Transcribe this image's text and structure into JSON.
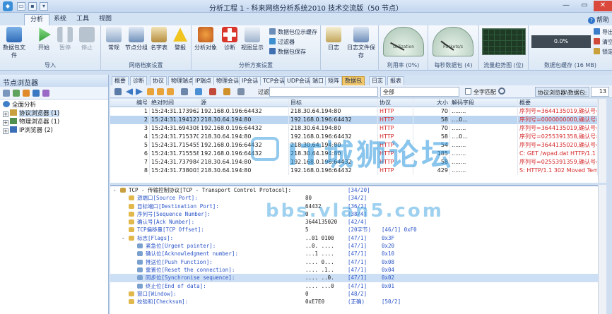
{
  "window": {
    "title": "分析工程 1 - 科来网络分析系统2010 技术交流版（50 节点）",
    "help_label": "帮助",
    "close_glyph": "✕",
    "minimize_glyph": "—",
    "maximize_glyph": "▭"
  },
  "ribbon_tabs": [
    "分析",
    "系统",
    "工具",
    "视图"
  ],
  "ribbon": {
    "groups": [
      {
        "label": "导入",
        "buttons": [
          {
            "label": "数据包文件"
          },
          {
            "label": "开始"
          },
          {
            "label": "暂停"
          },
          {
            "label": "停止"
          }
        ]
      },
      {
        "label": "网络档案设置",
        "buttons": [
          {
            "label": "常规"
          },
          {
            "label": "节点分组"
          },
          {
            "label": "名字表"
          },
          {
            "label": "警报"
          }
        ]
      },
      {
        "label": "分析方案设置",
        "buttons": [
          {
            "label": "分析对象"
          },
          {
            "label": "诊断"
          },
          {
            "label": "视图显示"
          }
        ],
        "small": [
          "数据包位示缓存",
          "过滤器",
          "数据包保存"
        ]
      },
      {
        "label": "",
        "buttons": [
          {
            "label": "日志"
          },
          {
            "label": "日志文件保存"
          }
        ]
      },
      {
        "label": "利用率 (0%)",
        "gauge": "Utilization"
      },
      {
        "label": "每秒数据包 (4)",
        "gauge": "Packets/s"
      },
      {
        "label": "流量趋势图 (位)"
      },
      {
        "label": "数据包缓存 (16 MB)",
        "buffer_value": "0.0%",
        "small": [
          "导出",
          "清空",
          "锁定"
        ]
      }
    ]
  },
  "left_panel": {
    "title": "节点浏览器",
    "tree": [
      {
        "label": "全面分析",
        "level": 0,
        "expander": ""
      },
      {
        "label": "协议浏览器 (1)",
        "level": 1,
        "expander": "+",
        "selected": true
      },
      {
        "label": "物理浏览器 (1)",
        "level": 1,
        "expander": "+"
      },
      {
        "label": "IP浏览器 (2)",
        "level": 1,
        "expander": "+"
      }
    ]
  },
  "doc_tabs": [
    "概要",
    "诊断",
    "协议",
    "物理端点",
    "IP端点",
    "物理会话",
    "IP会话",
    "TCP会话",
    "UDP会话",
    "端口",
    "矩阵",
    "数据包",
    "日志",
    "报表"
  ],
  "active_doc_tab": "数据包",
  "filter_bar": {
    "filter_label": "过滤:",
    "select_value": "全部",
    "match_label": "全字匹配",
    "browser_label": "协议浏览器\\数据包:",
    "count": "13"
  },
  "packets": {
    "columns": [
      "编号",
      "绝对时间",
      "源",
      "目标",
      "协议",
      "大小",
      "解码字段",
      "概要"
    ],
    "rows": [
      [
        "1",
        "15:24:31.173962",
        "192.168.0.196:64432",
        "218.30.64.194:80",
        "HTTP",
        "70",
        "........",
        "序列号=3644135019,确认号=0"
      ],
      [
        "2",
        "15:24:31.194121",
        "218.30.64.194:80",
        "192.168.0.196:64432",
        "HTTP",
        "58",
        "....0...",
        "序列号=0000000000,确认号=3"
      ],
      [
        "3",
        "15:24:31.694308",
        "192.168.0.196:64432",
        "218.30.64.194:80",
        "HTTP",
        "70",
        "........",
        "序列号=3644135019,确认号=0"
      ],
      [
        "4",
        "15:24:31.715370",
        "218.30.64.194:80",
        "192.168.0.196:64432",
        "HTTP",
        "58",
        "....0...",
        "序列号=0255391358,确认号=3"
      ],
      [
        "5",
        "15:24:31.715455",
        "192.168.0.196:64432",
        "218.30.64.194:80",
        "HTTP",
        "54",
        "........",
        "序列号=3644135020,确认号=0"
      ],
      [
        "6",
        "15:24:31.715558",
        "192.168.0.196:64432",
        "218.30.64.194:80",
        "HTTP",
        "185",
        "........",
        "C: GET /wpad.dat HTTP/1.1"
      ],
      [
        "7",
        "15:24:31.737984",
        "218.30.64.194:80",
        "192.168.0.196:64432",
        "HTTP",
        "58",
        "........",
        "序列号=0255391359,确认号=3"
      ],
      [
        "8",
        "15:24:31.738003",
        "218.30.64.194:80",
        "192.168.0.196:64432",
        "HTTP",
        "429",
        "........",
        "S: HTTP/1.1 302 Moved Temp"
      ]
    ]
  },
  "decode": {
    "rows": [
      {
        "indent": 0,
        "exp": "-",
        "name": "TCP - 传输控制协议[TCP - Transport Control Protocol]:",
        "value": "",
        "pos": "[34/20]",
        "extra": ""
      },
      {
        "indent": 1,
        "exp": "",
        "name": "源端口[Source Port]:",
        "value": "80",
        "pos": "[34/2]",
        "extra": ""
      },
      {
        "indent": 1,
        "exp": "",
        "name": "目标端口[Destination Port]:",
        "value": "64432",
        "pos": "[36/2]",
        "extra": ""
      },
      {
        "indent": 1,
        "exp": "",
        "name": "序列号[Sequence Number]:",
        "value": "0",
        "pos": "[38/4]",
        "extra": ""
      },
      {
        "indent": 1,
        "exp": "",
        "name": "确认号[Ack Number]:",
        "value": "3644135020",
        "pos": "[42/4]",
        "extra": ""
      },
      {
        "indent": 1,
        "exp": "",
        "name": "TCP偏移量[TCP Offset]:",
        "value": "5",
        "pos": "(20字节)",
        "extra": "[46/1]   0xF0"
      },
      {
        "indent": 1,
        "exp": "-",
        "name": "标志[Flags]:",
        "value": "..01 0100",
        "pos": "[47/1]",
        "extra": "0x3F"
      },
      {
        "indent": 2,
        "exp": "",
        "name": "紧急位[Urgent pointer]:",
        "value": "..0. ....",
        "pos": "[47/1]",
        "extra": "0x20"
      },
      {
        "indent": 2,
        "exp": "",
        "name": "确认位[Acknowledgment number]:",
        "value": "...1 ....",
        "pos": "[47/1]",
        "extra": "0x10"
      },
      {
        "indent": 2,
        "exp": "",
        "name": "推送位[Push Function]:",
        "value": ".... 0...",
        "pos": "[47/1]",
        "extra": "0x08"
      },
      {
        "indent": 2,
        "exp": "",
        "name": "重置位[Reset the connection]:",
        "value": ".... .1..",
        "pos": "[47/1]",
        "extra": "0x04"
      },
      {
        "indent": 2,
        "exp": "",
        "name": "同步位[Synchronise sequence]:",
        "value": ".... ..0.",
        "pos": "[47/1]",
        "extra": "0x02",
        "highlight": true
      },
      {
        "indent": 2,
        "exp": "",
        "name": "终止位[End of data]:",
        "value": ".... ...0",
        "pos": "[47/1]",
        "extra": "0x01"
      },
      {
        "indent": 1,
        "exp": "",
        "name": "窗口[Window]:",
        "value": "0",
        "pos": "[48/2]",
        "extra": ""
      },
      {
        "indent": 1,
        "exp": "",
        "name": "校验和[Checksum]:",
        "value": "0xE7E0",
        "pos": "(正确)",
        "extra": "[50/2]"
      }
    ]
  },
  "watermark": {
    "title": "IT城狮论坛",
    "url": "bbs.vlan5.com"
  },
  "colors": {
    "accent": "#2f74c9",
    "protocol": "#d4282a",
    "selection": "#bcd6f2"
  }
}
